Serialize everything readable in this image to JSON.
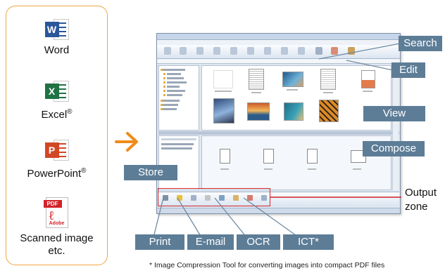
{
  "source_formats": [
    {
      "name": "Word",
      "tile": "W",
      "tile_color": "#2b579a"
    },
    {
      "name": "Excel",
      "mark": "®",
      "tile": "X",
      "tile_color": "#1f7244"
    },
    {
      "name": "PowerPoint",
      "mark": "®",
      "tile": "P",
      "tile_color": "#d24726"
    }
  ],
  "scanned": {
    "line1": "Scanned image",
    "line2": "etc.",
    "pdf_tag": "PDF",
    "pdf_brand": "Adobe"
  },
  "callouts": {
    "search": "Search",
    "edit": "Edit",
    "view": "View",
    "compose": "Compose",
    "store": "Store",
    "print": "Print",
    "email": "E-mail",
    "ocr": "OCR",
    "ict": "ICT*"
  },
  "output_zone": {
    "line1": "Output",
    "line2": "zone"
  },
  "footnote": "* Image Compression Tool for converting images into compact PDF files",
  "colors": {
    "accent_orange": "#f0a640",
    "callout_fill": "#5d7d97",
    "zone_outline": "#d2232a",
    "arrow": "#f08c1a"
  }
}
